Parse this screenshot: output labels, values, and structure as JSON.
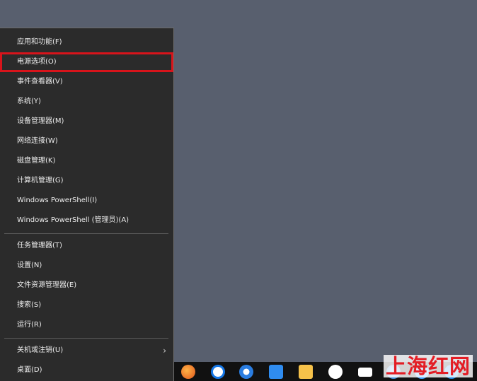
{
  "menu": {
    "group1": [
      {
        "label": "应用和功能(F)"
      },
      {
        "label": "电源选项(O)"
      },
      {
        "label": "事件查看器(V)"
      },
      {
        "label": "系统(Y)"
      },
      {
        "label": "设备管理器(M)"
      },
      {
        "label": "网络连接(W)"
      },
      {
        "label": "磁盘管理(K)"
      },
      {
        "label": "计算机管理(G)"
      },
      {
        "label": "Windows PowerShell(I)"
      },
      {
        "label": "Windows PowerShell (管理员)(A)"
      }
    ],
    "group2": [
      {
        "label": "任务管理器(T)"
      },
      {
        "label": "设置(N)"
      },
      {
        "label": "文件资源管理器(E)"
      },
      {
        "label": "搜索(S)"
      },
      {
        "label": "运行(R)"
      }
    ],
    "group3": [
      {
        "label": "关机或注销(U)",
        "submenu_icon": "chevron-right-icon"
      },
      {
        "label": "桌面(D)"
      }
    ],
    "highlight_color": "#d8141b"
  },
  "taskbar": {
    "icons": [
      "firefox-icon",
      "qq-browser-icon",
      "sogou-icon",
      "feishu-icon",
      "folder-icon",
      "wechat-icon",
      "mail-icon",
      "edge-icon",
      "browser-icon",
      "qq-icon"
    ]
  },
  "watermark": "上海红网"
}
